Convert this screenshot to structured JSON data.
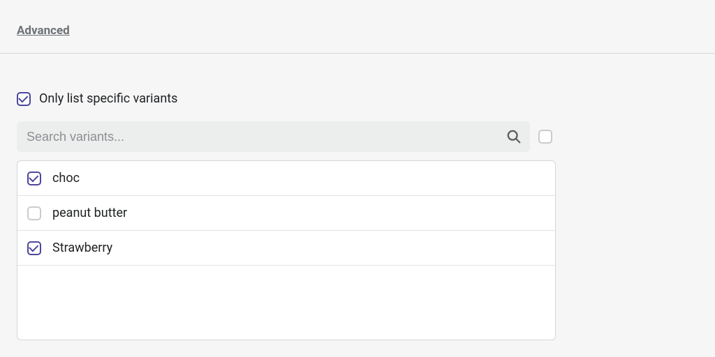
{
  "header": {
    "advanced_label": "Advanced"
  },
  "section": {
    "only_list_label": "Only list specific variants",
    "only_list_checked": true,
    "search": {
      "placeholder": "Search variants..."
    },
    "select_all_checked": false,
    "variants": [
      {
        "name": "choc",
        "checked": true
      },
      {
        "name": "peanut butter",
        "checked": false
      },
      {
        "name": "Strawberry",
        "checked": true
      }
    ]
  }
}
